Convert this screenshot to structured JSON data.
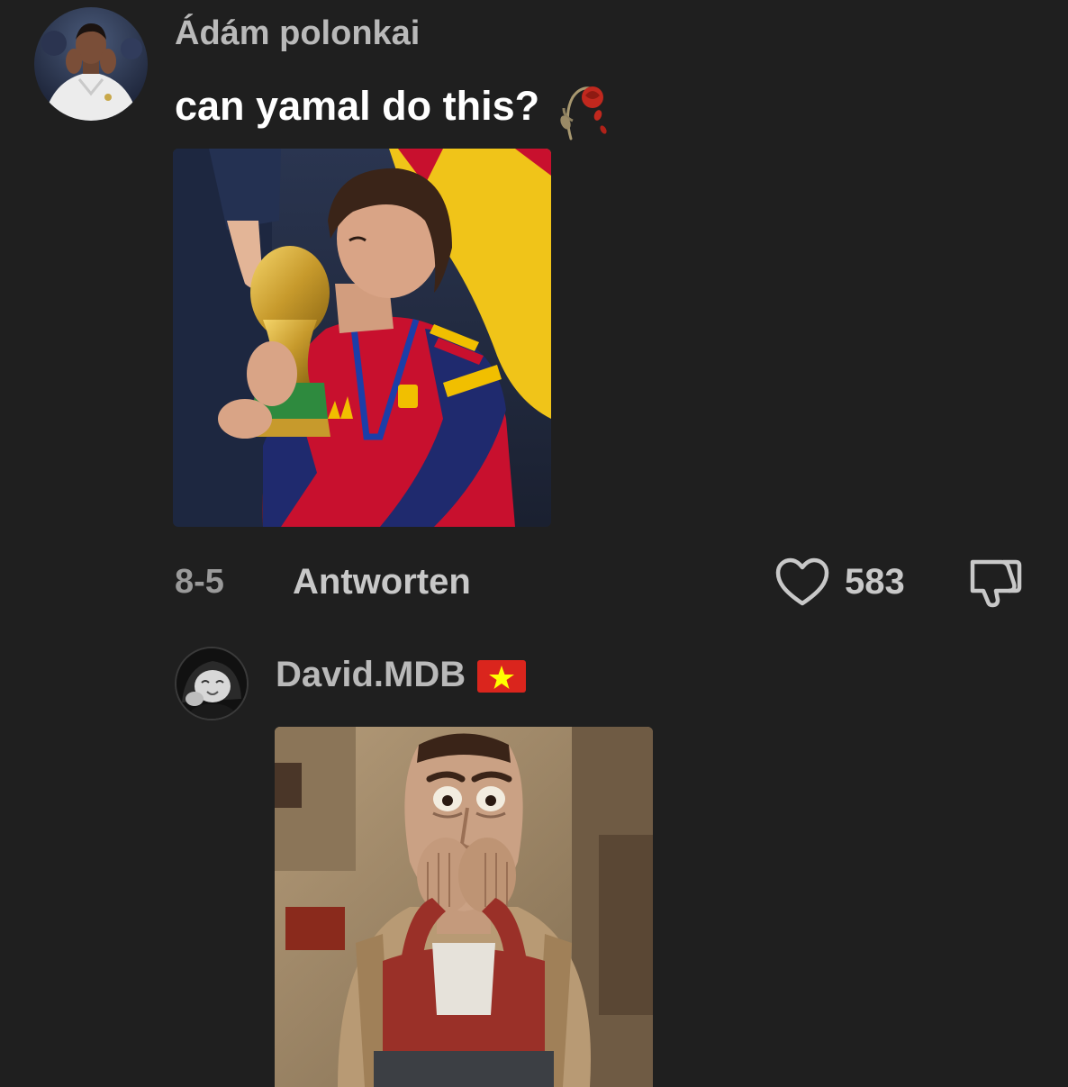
{
  "comments": [
    {
      "username": "Ádám polonkai",
      "text": "can yamal do this?",
      "text_emoji": "wilted-rose",
      "avatar_icon": "player-portrait",
      "image_description_icon": "trophy-kiss-photo",
      "date": "8-5",
      "reply_label": "Antworten",
      "like_count": "583",
      "icons": {
        "like": "heart-outline-icon",
        "dislike": "thumbs-down-outline-icon"
      }
    },
    {
      "username": "David.MDB",
      "flag": "vietnam-flag",
      "avatar_icon": "baby-bw-portrait",
      "image_description_icon": "cartoon-shocked-man"
    }
  ],
  "colors": {
    "background": "#1f1f1f",
    "username": "#b9b9b9",
    "text": "#ffffff",
    "muted": "#9a9a9a",
    "vietnam_red": "#da251d",
    "vietnam_yellow": "#ffff00",
    "spain_red": "#c8102e",
    "spain_yellow": "#f1bf00"
  }
}
